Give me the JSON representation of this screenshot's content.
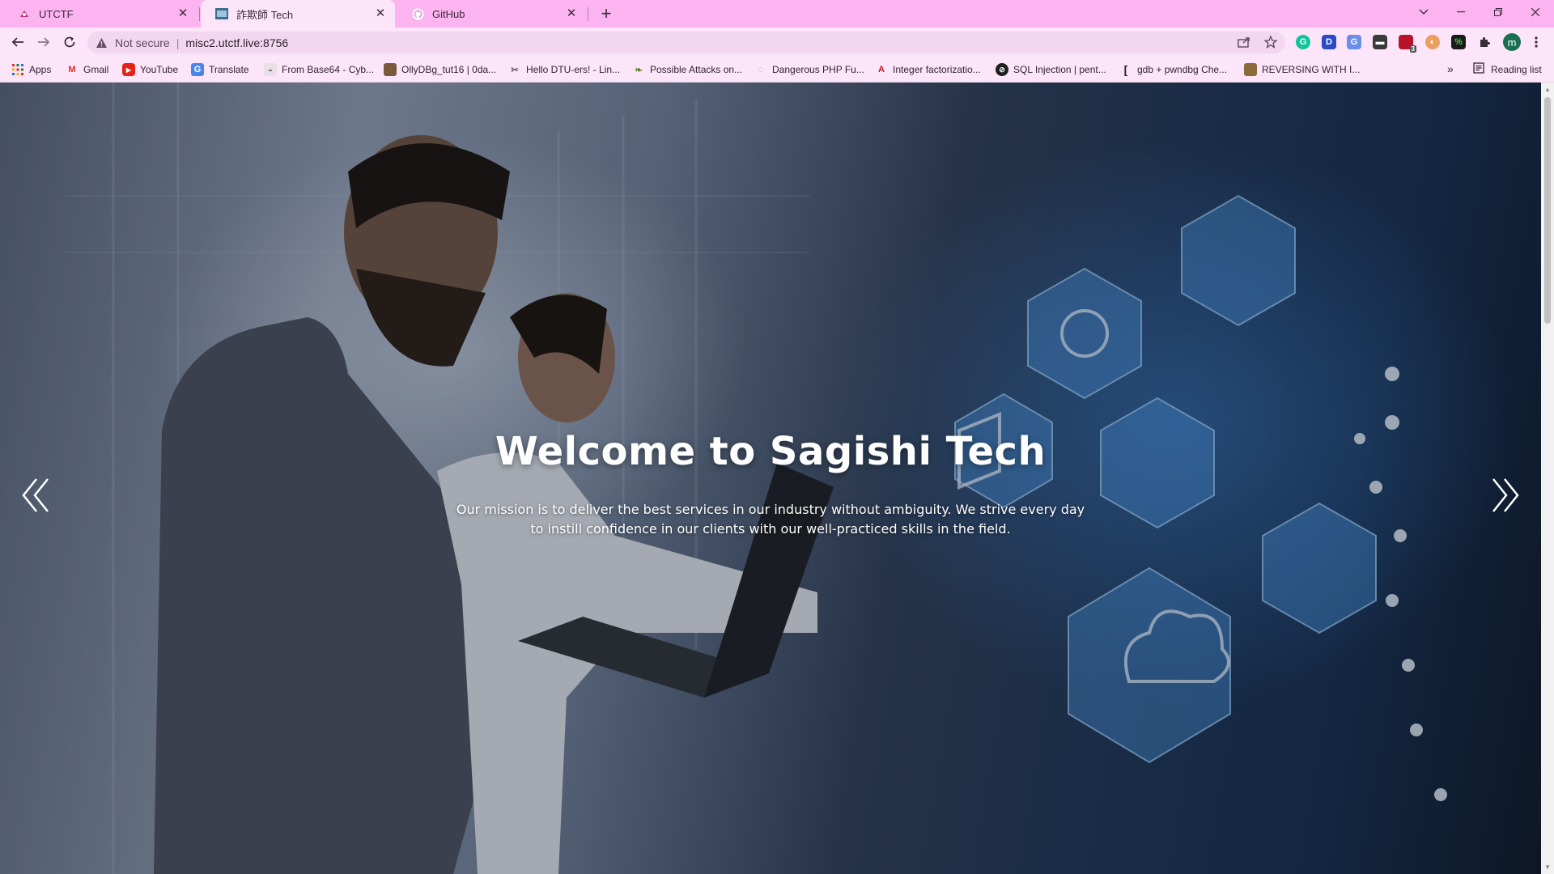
{
  "browser": {
    "tabs": [
      {
        "title": "UTCTF",
        "icon": "utctf-favicon-icon"
      },
      {
        "title": "詐欺師 Tech",
        "icon": "sagishi-favicon-icon"
      },
      {
        "title": "GitHub",
        "icon": "github-icon"
      }
    ],
    "address": {
      "security_label": "Not secure",
      "url": "misc2.utctf.live:8756"
    },
    "bookmarks": [
      {
        "label": "Apps",
        "icon": "apps-grid-icon"
      },
      {
        "label": "Gmail",
        "icon": "gmail-icon"
      },
      {
        "label": "YouTube",
        "icon": "youtube-icon"
      },
      {
        "label": "Translate",
        "icon": "translate-icon"
      },
      {
        "label": "From Base64 - Cyb...",
        "icon": "cyberchef-icon"
      },
      {
        "label": "OllyDBg_tut16 | 0da...",
        "icon": "bookmark-image-icon"
      },
      {
        "label": "Hello DTU-ers! - Lin...",
        "icon": "bookmark-tool-icon"
      },
      {
        "label": "Possible Attacks on...",
        "icon": "leaf-icon"
      },
      {
        "label": "Dangerous PHP Fu...",
        "icon": "globe-icon"
      },
      {
        "label": "Integer factorizatio...",
        "icon": "alpertron-icon"
      },
      {
        "label": "SQL Injection | pent...",
        "icon": "pentest-icon"
      },
      {
        "label": "gdb + pwndbg Che...",
        "icon": "bookmark-doc-icon"
      },
      {
        "label": "REVERSING WITH I...",
        "icon": "bookmark-image-icon"
      }
    ],
    "more_bookmarks": "»",
    "reading_list": "Reading list",
    "profile_initial": "m",
    "ext_badge": "3",
    "colors": {
      "tabstrip": "#fbb4f0",
      "toolbar": "#fde5f9"
    }
  },
  "hero": {
    "title": "Welcome to Sagishi Tech",
    "subtitle": "Our mission is to deliver the best services in our industry without ambiguity. We strive every day to instill confidence in our clients with our well-practiced skills in the field."
  }
}
